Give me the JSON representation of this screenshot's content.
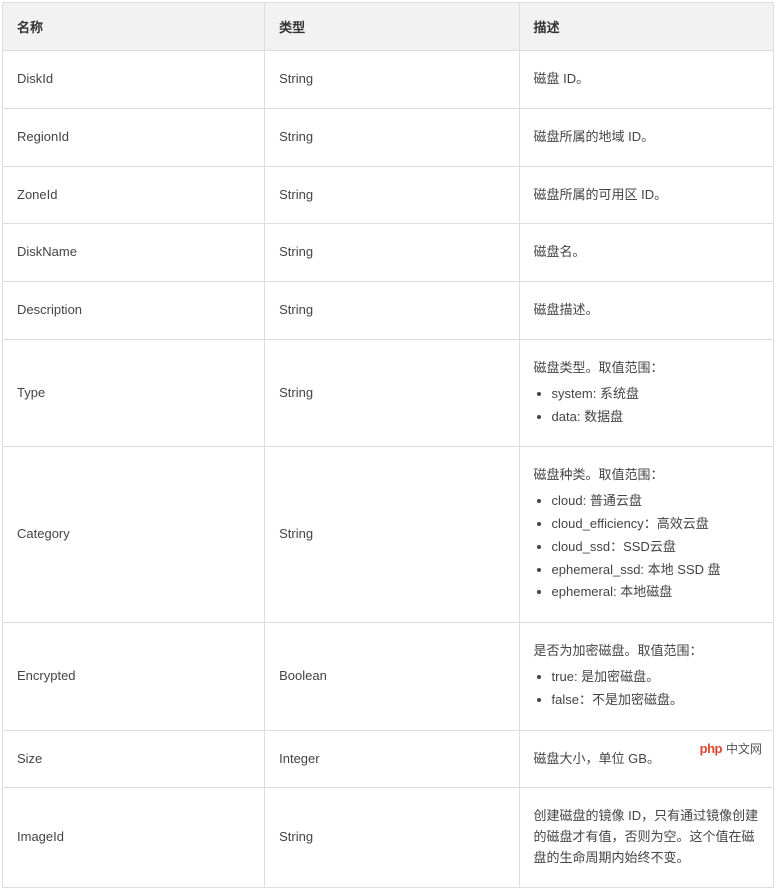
{
  "table": {
    "headers": {
      "name": "名称",
      "type": "类型",
      "desc": "描述"
    },
    "rows": [
      {
        "name": "DiskId",
        "type": "String",
        "desc_text": "磁盘 ID。"
      },
      {
        "name": "RegionId",
        "type": "String",
        "desc_text": "磁盘所属的地域 ID。"
      },
      {
        "name": "ZoneId",
        "type": "String",
        "desc_text": "磁盘所属的可用区 ID。"
      },
      {
        "name": "DiskName",
        "type": "String",
        "desc_text": "磁盘名。"
      },
      {
        "name": "Description",
        "type": "String",
        "desc_text": "磁盘描述。"
      },
      {
        "name": "Type",
        "type": "String",
        "desc_intro": "磁盘类型。取值范围：",
        "desc_list": [
          "system: 系统盘",
          "data: 数据盘"
        ]
      },
      {
        "name": "Category",
        "type": "String",
        "desc_intro": "磁盘种类。取值范围：",
        "desc_list": [
          "cloud: 普通云盘",
          "cloud_efficiency：高效云盘",
          "cloud_ssd：SSD云盘",
          "ephemeral_ssd: 本地 SSD 盘",
          "ephemeral: 本地磁盘"
        ]
      },
      {
        "name": "Encrypted",
        "type": "Boolean",
        "desc_intro": "是否为加密磁盘。取值范围：",
        "desc_list": [
          "true: 是加密磁盘。",
          "false：不是加密磁盘。"
        ]
      },
      {
        "name": "Size",
        "type": "Integer",
        "desc_text": "磁盘大小，单位 GB。"
      },
      {
        "name": "ImageId",
        "type": "String",
        "desc_text": "创建磁盘的镜像 ID，只有通过镜像创建的磁盘才有值，否则为空。这个值在磁盘的生命周期内始终不变。"
      }
    ]
  },
  "watermark": {
    "logo": "php",
    "text": "中文网"
  }
}
